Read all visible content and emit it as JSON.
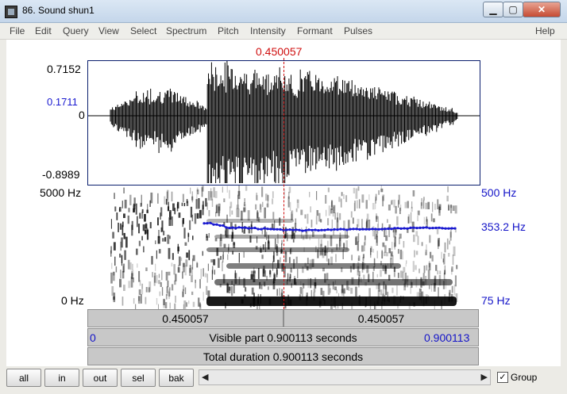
{
  "window": {
    "title": "86. Sound shun1"
  },
  "menu": [
    "File",
    "Edit",
    "Query",
    "View",
    "Select",
    "Spectrum",
    "Pitch",
    "Intensity",
    "Formant",
    "Pulses",
    "Help"
  ],
  "waveform": {
    "y_max": "0.7152",
    "y_mark": "0.1711",
    "y_zero": "0",
    "y_min": "-0.8989"
  },
  "spectrogram": {
    "freq_top": "5000 Hz",
    "freq_bottom": "0 Hz"
  },
  "pitch": {
    "top": "500 Hz",
    "value": "353.2 Hz",
    "bottom": "75 Hz",
    "color": "#1a1ad0"
  },
  "cursor": {
    "time": "0.450057",
    "color": "#d01010"
  },
  "time_bars": {
    "left_segment": "0.450057",
    "right_segment": "0.450057",
    "visible_start": "0",
    "visible_label": "Visible part 0.900113 seconds",
    "visible_end": "0.900113",
    "total_label": "Total duration 0.900113 seconds"
  },
  "buttons": {
    "all": "all",
    "in": "in",
    "out": "out",
    "sel": "sel",
    "bak": "bak"
  },
  "group": {
    "label": "Group",
    "checked": "✓"
  },
  "icons": {
    "app": "praat-sound-icon",
    "minimize": "minimize-icon",
    "maximize": "maximize-icon",
    "close": "close-icon"
  },
  "window_controls": {
    "minimize": "▁",
    "maximize": "▢",
    "close": "✕"
  },
  "scroll": {
    "left": "◀",
    "right": "▶"
  }
}
